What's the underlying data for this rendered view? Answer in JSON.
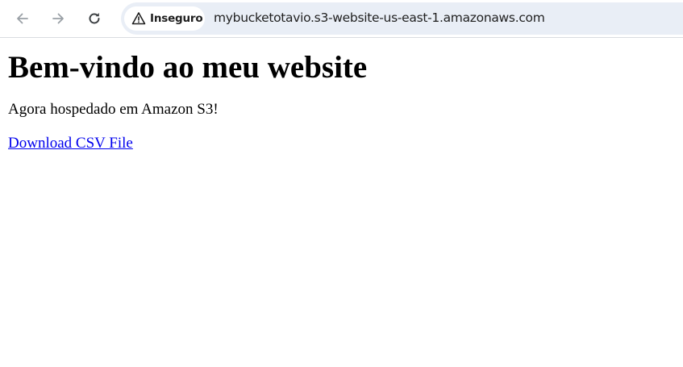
{
  "browser": {
    "back_icon": "arrow-left-icon",
    "forward_icon": "arrow-right-icon",
    "reload_icon": "reload-icon",
    "security": {
      "icon": "warning-triangle-icon",
      "label": "Inseguro"
    },
    "address": "mybucketotavio.s3-website-us-east-1.amazonaws.com",
    "colors": {
      "omnibox_bg": "#e9eef6",
      "icon_gray": "#5f6368"
    }
  },
  "page": {
    "heading": "Bem-vindo ao meu website",
    "paragraph": "Agora hospedado em Amazon S3!",
    "download_link": "Download CSV File",
    "colors": {
      "link": "#0000ee",
      "text": "#000000"
    }
  }
}
